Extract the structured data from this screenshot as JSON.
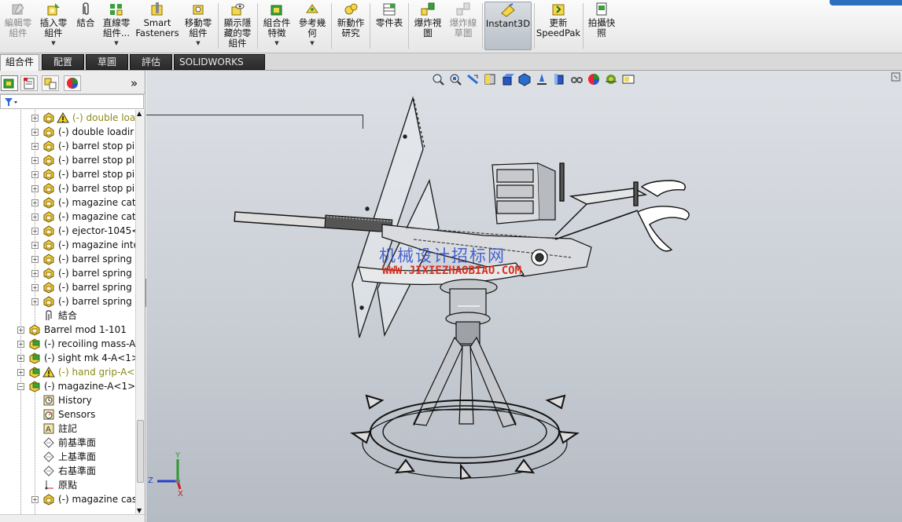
{
  "ribbon": {
    "buttons": [
      {
        "id": "edit-component",
        "label": "編輯零\n組件",
        "icon": "edit-component-icon",
        "disabled": true
      },
      {
        "id": "insert-component",
        "label": "插入零\n組件",
        "icon": "insert-component-icon",
        "disabled": false
      },
      {
        "id": "mate",
        "label": "結合",
        "icon": "mate-icon",
        "disabled": false
      },
      {
        "id": "linear-pattern",
        "label": "直線零\n組件...",
        "icon": "linear-pattern-icon",
        "disabled": false
      },
      {
        "id": "smart-fasteners",
        "label": "Smart\nFasteners",
        "icon": "smart-fasteners-icon",
        "disabled": false
      },
      {
        "id": "move-component",
        "label": "移動零\n組件",
        "icon": "move-component-icon",
        "disabled": false
      },
      {
        "id": "show-hidden",
        "label": "顯示隱\n藏的零\n組件",
        "icon": "show-hidden-icon",
        "disabled": false
      },
      {
        "id": "assembly-features",
        "label": "組合件\n特徵",
        "icon": "assembly-features-icon",
        "disabled": false
      },
      {
        "id": "reference-geometry",
        "label": "參考幾\n何",
        "icon": "reference-geometry-icon",
        "disabled": false
      },
      {
        "id": "new-motion-study",
        "label": "新動作\n研究",
        "icon": "motion-study-icon",
        "disabled": false
      },
      {
        "id": "bom",
        "label": "零件表",
        "icon": "bom-icon",
        "disabled": false
      },
      {
        "id": "exploded-view",
        "label": "爆炸視\n圖",
        "icon": "exploded-view-icon",
        "disabled": false
      },
      {
        "id": "explode-line-sketch",
        "label": "爆炸線\n草圖",
        "icon": "explode-line-icon",
        "disabled": true
      },
      {
        "id": "instant3d",
        "label": "Instant3D",
        "icon": "instant3d-icon",
        "disabled": false
      },
      {
        "id": "update-speedpak",
        "label": "更新\nSpeedPak",
        "icon": "speedpak-icon",
        "disabled": false
      },
      {
        "id": "snapshot",
        "label": "拍攝快\n照",
        "icon": "snapshot-icon",
        "disabled": false
      }
    ]
  },
  "tabs": [
    "組合件",
    "配置",
    "草圖",
    "評估",
    "SOLIDWORKS MBD"
  ],
  "tree": {
    "items": [
      {
        "label": "(-) double loa",
        "level": 2,
        "icon": "part-icon",
        "warn": true
      },
      {
        "label": "(-) double loadir",
        "level": 2,
        "icon": "part-icon",
        "warn": false
      },
      {
        "label": "(-) barrel stop pi",
        "level": 2,
        "icon": "part-icon",
        "warn": false
      },
      {
        "label": "(-) barrel stop plu",
        "level": 2,
        "icon": "part-icon",
        "warn": false
      },
      {
        "label": "(-) barrel stop pi",
        "level": 2,
        "icon": "part-icon",
        "warn": false
      },
      {
        "label": "(-) barrel stop pi",
        "level": 2,
        "icon": "part-icon",
        "warn": false
      },
      {
        "label": "(-) magazine cat",
        "level": 2,
        "icon": "part-icon",
        "warn": false
      },
      {
        "label": "(-) magazine cat",
        "level": 2,
        "icon": "part-icon",
        "warn": false
      },
      {
        "label": "(-) ejector-1045<",
        "level": 2,
        "icon": "part-icon",
        "warn": false
      },
      {
        "label": "(-) magazine inte",
        "level": 2,
        "icon": "part-icon",
        "warn": false
      },
      {
        "label": "(-) barrel spring s",
        "level": 2,
        "icon": "part-icon",
        "warn": false
      },
      {
        "label": "(-) barrel spring l",
        "level": 2,
        "icon": "part-icon",
        "warn": false
      },
      {
        "label": "(-) barrel spring s",
        "level": 2,
        "icon": "part-icon",
        "warn": false
      },
      {
        "label": "(-) barrel spring s",
        "level": 2,
        "icon": "part-icon",
        "warn": false
      },
      {
        "label": "結合",
        "level": 2,
        "icon": "mates-icon",
        "warn": false,
        "noexp": true
      },
      {
        "label": "Barrel mod 1-101",
        "level": 1,
        "icon": "part-icon",
        "warn": false
      },
      {
        "label": "(-) recoiling mass-A",
        "level": 1,
        "icon": "assembly-icon",
        "warn": false
      },
      {
        "label": "(-) sight mk 4-A<1>",
        "level": 1,
        "icon": "assembly-icon",
        "warn": false
      },
      {
        "label": "(-) hand grip-A<",
        "level": 1,
        "icon": "assembly-icon",
        "warn": true
      },
      {
        "label": "(-) magazine-A<1>",
        "level": 1,
        "icon": "assembly-icon",
        "warn": false,
        "open": true
      },
      {
        "label": "History",
        "level": 2,
        "icon": "history-icon",
        "warn": false,
        "noexp": true
      },
      {
        "label": "Sensors",
        "level": 2,
        "icon": "sensors-icon",
        "warn": false,
        "noexp": true
      },
      {
        "label": "註記",
        "level": 2,
        "icon": "annotations-icon",
        "warn": false,
        "noexp": true
      },
      {
        "label": "前基準面",
        "level": 2,
        "icon": "plane-icon",
        "warn": false,
        "noexp": true
      },
      {
        "label": "上基準面",
        "level": 2,
        "icon": "plane-icon",
        "warn": false,
        "noexp": true
      },
      {
        "label": "右基準面",
        "level": 2,
        "icon": "plane-icon",
        "warn": false,
        "noexp": true
      },
      {
        "label": "原點",
        "level": 2,
        "icon": "origin-icon",
        "warn": false,
        "noexp": true
      },
      {
        "label": "(-) magazine cas",
        "level": 2,
        "icon": "part-icon",
        "warn": false
      }
    ]
  },
  "viewport": {
    "watermark_cn": "机械设计招标网",
    "watermark_url": "WWW.JIXIEZHAOBIAO.COM",
    "axes": {
      "y": "Y",
      "z": "Z",
      "x": "X"
    },
    "colors": {
      "x": "#d01818",
      "y": "#2c9a2c",
      "z": "#2340c8"
    }
  }
}
